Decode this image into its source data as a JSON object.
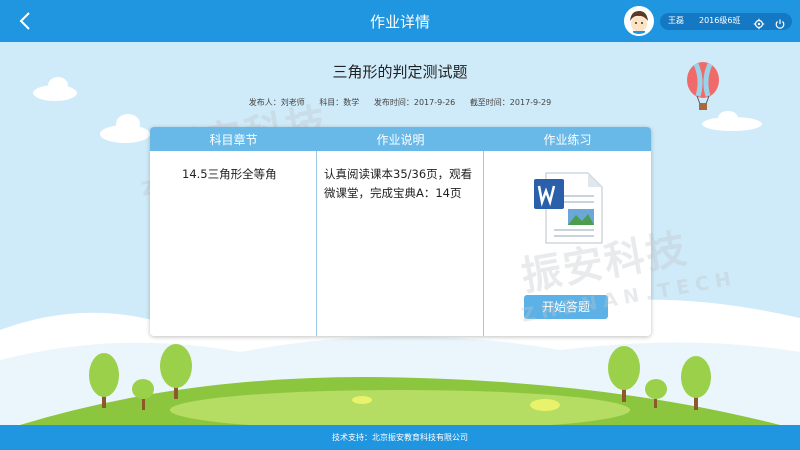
{
  "header": {
    "title": "作业详情",
    "user_name": "王磊",
    "user_class": "2016级6班"
  },
  "homework": {
    "title": "三角形的判定测试题",
    "publisher": "发布人：刘老师",
    "subject": "科目：数学",
    "publish_time": "发布时间：2017-9-26",
    "deadline": "截至时间：2017-9-29"
  },
  "table": {
    "headers": [
      "科目章节",
      "作业说明",
      "作业练习"
    ],
    "chapter": "14.5三角形全等角",
    "description_line1": "认真阅读课本35/36页，观看",
    "description_line2": "微课堂，完成宝典A：14页",
    "attachment_icon": "word-document-icon",
    "start_button": "开始答题"
  },
  "watermark": {
    "cn": "振安科技",
    "en": "ZHENAN.TECH"
  },
  "footer": {
    "text": "技术支持：北京振安教育科技有限公司"
  },
  "colors": {
    "primary": "#2196e0",
    "table_header": "#69b9e8",
    "button": "#5cb2e6",
    "sky": "#cfeaf8",
    "grass": "#8cc63f"
  }
}
